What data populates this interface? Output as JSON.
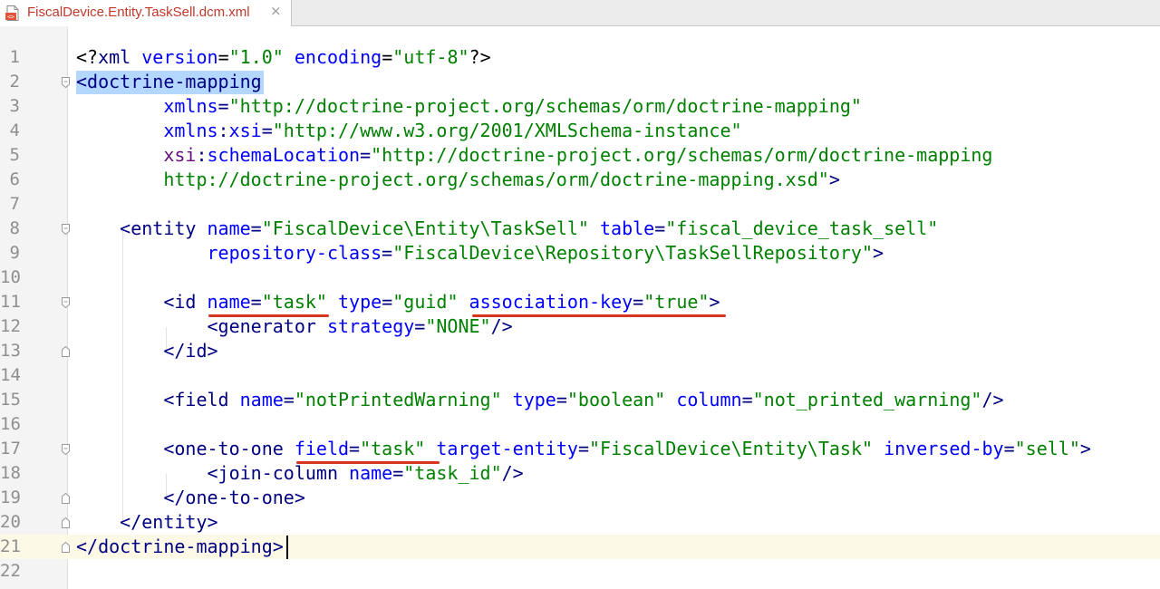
{
  "tab": {
    "label": "FiscalDevice.Entity.TaskSell.dcm.xml",
    "close": "×",
    "icon": "xml-file-icon"
  },
  "colors": {
    "tag": "#000080",
    "attribute": "#0000ff",
    "namespace": "#660e7a",
    "value": "#008000",
    "selection": "#b3d7ff",
    "current_line": "#fcfae6",
    "annotation_underline": "#d9341f"
  },
  "editor": {
    "current_line": 21,
    "lines": [
      {
        "n": "1",
        "tokens": [
          [
            "pi",
            "<?"
          ],
          [
            "tag",
            "xml"
          ],
          [
            "pi",
            " "
          ],
          [
            "attr",
            "version"
          ],
          [
            "pi",
            "="
          ],
          [
            "val",
            "\"1.0\""
          ],
          [
            "pi",
            " "
          ],
          [
            "attr",
            "encoding"
          ],
          [
            "pi",
            "="
          ],
          [
            "val",
            "\"utf-8\""
          ],
          [
            "pi",
            "?>"
          ]
        ]
      },
      {
        "n": "2",
        "tokens": [
          [
            "tag",
            "<doctrine-mapping"
          ]
        ]
      },
      {
        "n": "3",
        "tokens": [
          [
            "txt",
            "        "
          ],
          [
            "attr",
            "xmlns"
          ],
          [
            "tag",
            "="
          ],
          [
            "val",
            "\"http://doctrine-project.org/schemas/orm/doctrine-mapping\""
          ]
        ]
      },
      {
        "n": "4",
        "tokens": [
          [
            "txt",
            "        "
          ],
          [
            "attr",
            "xmlns"
          ],
          [
            "tag",
            ":"
          ],
          [
            "attr",
            "xsi"
          ],
          [
            "tag",
            "="
          ],
          [
            "val",
            "\"http://www.w3.org/2001/XMLSchema-instance\""
          ]
        ]
      },
      {
        "n": "5",
        "tokens": [
          [
            "txt",
            "        "
          ],
          [
            "ns",
            "xsi"
          ],
          [
            "tag",
            ":"
          ],
          [
            "attr",
            "schemaLocation"
          ],
          [
            "tag",
            "="
          ],
          [
            "val",
            "\"http://doctrine-project.org/schemas/orm/doctrine-mapping"
          ]
        ]
      },
      {
        "n": "6",
        "tokens": [
          [
            "txt",
            "        "
          ],
          [
            "val",
            "http://doctrine-project.org/schemas/orm/doctrine-mapping.xsd\""
          ],
          [
            "tag",
            ">"
          ]
        ]
      },
      {
        "n": "7",
        "tokens": []
      },
      {
        "n": "8",
        "tokens": [
          [
            "txt",
            "    "
          ],
          [
            "tag",
            "<entity "
          ],
          [
            "attr",
            "name"
          ],
          [
            "tag",
            "="
          ],
          [
            "val",
            "\"FiscalDevice\\Entity\\TaskSell\""
          ],
          [
            "tag",
            " "
          ],
          [
            "attr",
            "table"
          ],
          [
            "tag",
            "="
          ],
          [
            "val",
            "\"fiscal_device_task_sell\""
          ]
        ]
      },
      {
        "n": "9",
        "tokens": [
          [
            "txt",
            "            "
          ],
          [
            "attr",
            "repository-class"
          ],
          [
            "tag",
            "="
          ],
          [
            "val",
            "\"FiscalDevice\\Repository\\TaskSellRepository\""
          ],
          [
            "tag",
            ">"
          ]
        ]
      },
      {
        "n": "10",
        "tokens": []
      },
      {
        "n": "11",
        "tokens": [
          [
            "txt",
            "        "
          ],
          [
            "tag",
            "<id "
          ],
          [
            "attr",
            "name"
          ],
          [
            "tag",
            "="
          ],
          [
            "val",
            "\"task\""
          ],
          [
            "tag",
            " "
          ],
          [
            "attr",
            "type"
          ],
          [
            "tag",
            "="
          ],
          [
            "val",
            "\"guid\""
          ],
          [
            "tag",
            " "
          ],
          [
            "attr",
            "association-key"
          ],
          [
            "tag",
            "="
          ],
          [
            "val",
            "\"true\""
          ],
          [
            "tag",
            ">"
          ]
        ]
      },
      {
        "n": "12",
        "tokens": [
          [
            "txt",
            "            "
          ],
          [
            "tag",
            "<generator "
          ],
          [
            "attr",
            "strategy"
          ],
          [
            "tag",
            "="
          ],
          [
            "val",
            "\"NONE\""
          ],
          [
            "tag",
            "/>"
          ]
        ]
      },
      {
        "n": "13",
        "tokens": [
          [
            "txt",
            "        "
          ],
          [
            "tag",
            "</id>"
          ]
        ]
      },
      {
        "n": "14",
        "tokens": []
      },
      {
        "n": "15",
        "tokens": [
          [
            "txt",
            "        "
          ],
          [
            "tag",
            "<field "
          ],
          [
            "attr",
            "name"
          ],
          [
            "tag",
            "="
          ],
          [
            "val",
            "\"notPrintedWarning\""
          ],
          [
            "tag",
            " "
          ],
          [
            "attr",
            "type"
          ],
          [
            "tag",
            "="
          ],
          [
            "val",
            "\"boolean\""
          ],
          [
            "tag",
            " "
          ],
          [
            "attr",
            "column"
          ],
          [
            "tag",
            "="
          ],
          [
            "val",
            "\"not_printed_warning\""
          ],
          [
            "tag",
            "/>"
          ]
        ]
      },
      {
        "n": "16",
        "tokens": []
      },
      {
        "n": "17",
        "tokens": [
          [
            "txt",
            "        "
          ],
          [
            "tag",
            "<one-to-one "
          ],
          [
            "attr",
            "field"
          ],
          [
            "tag",
            "="
          ],
          [
            "val",
            "\"task\""
          ],
          [
            "tag",
            " "
          ],
          [
            "attr",
            "target-entity"
          ],
          [
            "tag",
            "="
          ],
          [
            "val",
            "\"FiscalDevice\\Entity\\Task\""
          ],
          [
            "tag",
            " "
          ],
          [
            "attr",
            "inversed-by"
          ],
          [
            "tag",
            "="
          ],
          [
            "val",
            "\"sell\""
          ],
          [
            "tag",
            ">"
          ]
        ]
      },
      {
        "n": "18",
        "tokens": [
          [
            "txt",
            "            "
          ],
          [
            "tag",
            "<join-column "
          ],
          [
            "attr",
            "name"
          ],
          [
            "tag",
            "="
          ],
          [
            "val",
            "\"task_id\""
          ],
          [
            "tag",
            "/>"
          ]
        ]
      },
      {
        "n": "19",
        "tokens": [
          [
            "txt",
            "        "
          ],
          [
            "tag",
            "</one-to-one>"
          ]
        ]
      },
      {
        "n": "20",
        "tokens": [
          [
            "txt",
            "    "
          ],
          [
            "tag",
            "</entity>"
          ]
        ]
      },
      {
        "n": "21",
        "tokens": [
          [
            "tag",
            "</doctrine-mapping>"
          ]
        ]
      },
      {
        "n": "22",
        "tokens": []
      }
    ]
  }
}
